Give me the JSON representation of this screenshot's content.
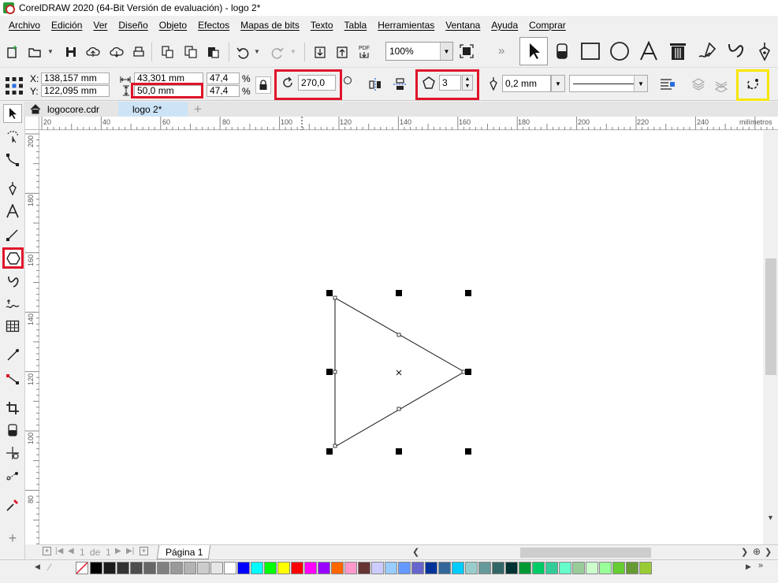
{
  "window": {
    "title": "CorelDRAW 2020 (64-Bit Versión de evaluación) - logo 2*"
  },
  "menu": {
    "items": [
      "Archivo",
      "Edición",
      "Ver",
      "Diseño",
      "Objeto",
      "Efectos",
      "Mapas de bits",
      "Texto",
      "Tabla",
      "Herramientas",
      "Ventana",
      "Ayuda",
      "Comprar"
    ]
  },
  "toolbar": {
    "zoom": "100%",
    "pdf_label": "PDF",
    "more": "»"
  },
  "properties": {
    "x_label": "X:",
    "x_value": "138,157 mm",
    "y_label": "Y:",
    "y_value": "122,095 mm",
    "width_value": "43,301 mm",
    "height_value": "50,0 mm",
    "scale_x": "47,4",
    "scale_y": "47,4",
    "percent": "%",
    "rotation": "270,0",
    "sides": "3",
    "outline_width": "0,2 mm"
  },
  "tabs": [
    {
      "label": "logocore.cdr"
    },
    {
      "label": "logo 2*"
    }
  ],
  "rulers": {
    "unit": "milímetros",
    "h_ticks": [
      "20",
      "40",
      "60",
      "80",
      "100",
      "120",
      "140",
      "160",
      "180",
      "200",
      "220",
      "240"
    ],
    "v_ticks": [
      "200",
      "180",
      "160",
      "140",
      "120",
      "100",
      "80"
    ]
  },
  "pagebar": {
    "page_of": "1",
    "of_label": "de",
    "page_total": "1",
    "page_tab": "Página 1"
  },
  "palette": {
    "colors": [
      "#000000",
      "#1a1a1a",
      "#333333",
      "#4d4d4d",
      "#666666",
      "#808080",
      "#999999",
      "#b3b3b3",
      "#cccccc",
      "#e6e6e6",
      "#ffffff",
      "#0000ff",
      "#00ffff",
      "#00ff00",
      "#ffff00",
      "#ff0000",
      "#ff00ff",
      "#9900ff",
      "#ff6600",
      "#ff99cc",
      "#663333",
      "#ccccff",
      "#99ccff",
      "#6699ff",
      "#6666cc",
      "#003399",
      "#336699",
      "#00ccff",
      "#99cccc",
      "#669999",
      "#336666",
      "#003333",
      "#009933",
      "#00cc66",
      "#33cc99",
      "#66ffcc",
      "#99cc99",
      "#ccffcc",
      "#99ff99",
      "#66cc33",
      "#669933",
      "#99cc33"
    ]
  }
}
